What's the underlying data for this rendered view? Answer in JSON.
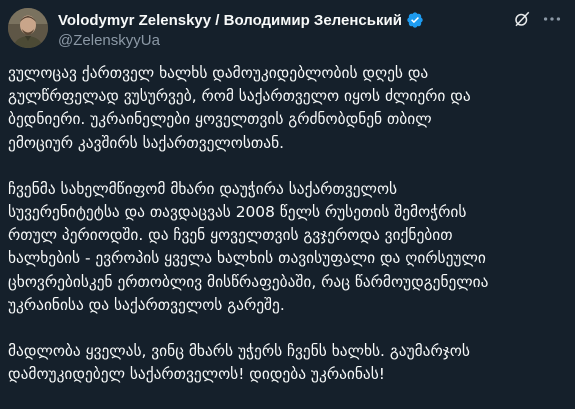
{
  "author": {
    "display_name": "Volodymyr Zelenskyy / Володимир Зеленський",
    "handle": "@ZelenskyyUa"
  },
  "icons": {
    "verified": "verified-badge-icon",
    "grok": "grok-icon",
    "more": "more-options-icon"
  },
  "colors": {
    "background": "#15202b",
    "text": "#f7f9f9",
    "secondary_text": "#8b98a5",
    "verified": "#1d9bf0"
  },
  "tweet": {
    "paragraphs": [
      "ვულოცავ ქართველ ხალხს დამოუკიდებლობის დღეს და\nგულწრფელად ვუსურვებ, რომ საქართველო იყოს ძლიერი და\nბედნიერი. უკრაინელები ყოველთვის გრძნობდნენ თბილ\nემოციურ კავშირს საქართველოსთან.",
      "ჩვენმა სახელმწიფომ მხარი დაუჭირა საქართველოს\nსუვერენიტეტსა და თავდაცვას 2008 წელს რუსეთის შემოჭრის\nრთულ პერიოდში. და ჩვენ ყოველთვის გვჯეროდა ვიქნებით\nხალხების - ევროპის ყველა ხალხის თავისუფალი და ღირსეული\nცხოვრებისკენ ერთობლივ მისწრაფებაში, რაც წარმოუდგენელია\nუკრაინისა და საქართველოს გარეშე.",
      "მადლობა ყველას, ვინც მხარს უჭერს ჩვენს ხალხს. გაუმარჯოს\nდამოუკიდებელ საქართველოს! დიდება უკრაინას!"
    ]
  }
}
